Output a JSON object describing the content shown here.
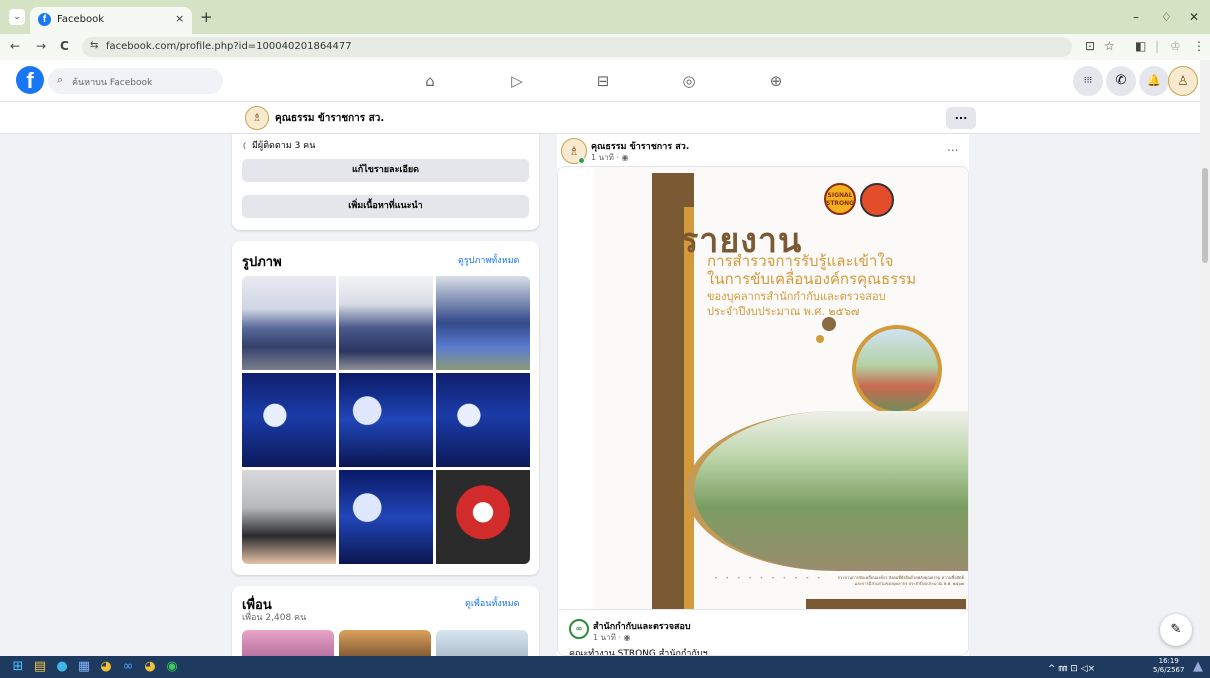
{
  "browser": {
    "tab_title": "Facebook",
    "tab_close": "×",
    "new_tab": "+",
    "tab_menu": "⌄",
    "win_min": "–",
    "win_max": "♢",
    "win_close": "✕",
    "back": "←",
    "forward": "→",
    "reload": "C",
    "site_info": "⇆",
    "url": "facebook.com/profile.php?id=100040201864477",
    "right_icons": [
      "⊡",
      "☆",
      "◧",
      "|",
      "♔",
      "⋮"
    ]
  },
  "fb_header": {
    "logo": "f",
    "search_icon": "⌕",
    "search_placeholder": "ค้นหาบน Facebook",
    "nav_icons": [
      "⌂",
      "▷",
      "⊟",
      "◎",
      "⊕"
    ],
    "right": [
      "⁝⁝⁝",
      "✆",
      "🔔",
      "♙"
    ]
  },
  "profile_bar": {
    "avatar": "♗",
    "name": "คุณธรรม ข้าราชการ สว.",
    "more": "..."
  },
  "left_col": {
    "followers_icon": "⦅",
    "followers": "มีผู้ติดตาม 3 คน",
    "edit_details": "แก้ไขรายละเอียด",
    "add_featured": "เพิ่มเนื้อหาที่แนะนำ",
    "photos_title": "รูปภาพ",
    "photos_link": "ดูรูปภาพทั้งหมด",
    "friends_title": "เพื่อน",
    "friends_count": "เพื่อน 2,408 คน",
    "friends_link": "ดูเพื่อนทั้งหมด"
  },
  "post": {
    "author": "คุณธรรม ข้าราชการ สว.",
    "time": "1 นาที · ◉",
    "more": "...",
    "poster": {
      "logo_text": "SIGNAL STRONG",
      "heading": "รายงาน",
      "line1": "การสำรวจการรับรู้และเข้าใจ",
      "line2": "ในการขับเคลื่อนองค์กรคุณธรรม",
      "line3": "ของบุคลากรสำนักกำกับและตรวจสอบ",
      "line4": "ประจำปีงบประมาณ พ.ศ. ๒๕๖๗",
      "dots": "• • • • • • • • • •",
      "small_print": "กระบวนการขับเคลื่อนองค์กร สังคมที่ยั่งยืนด้วยพลังคุณธรรม ความซื่อสัตย์ และการมีส่วนร่วมของบุคลากร ประจำปีงบประมาณ พ.ศ. ๒๕๖๗"
    },
    "shared_avatar": "∞",
    "shared_name": "สำนักกำกับและตรวจสอบ",
    "shared_time": "1 นาที · ◉",
    "shared_text": "คณะทำงาน STRONG สำนักกำกับฯ"
  },
  "compose_icon": "✎",
  "taskbar": {
    "icons": [
      "⊞",
      "▤",
      "●",
      "▦",
      "◕",
      "∞",
      "◕",
      "◉"
    ],
    "tray": "^  ㎜  ⊡ ◁×",
    "time": "16:19",
    "date": "5/6/2567"
  }
}
